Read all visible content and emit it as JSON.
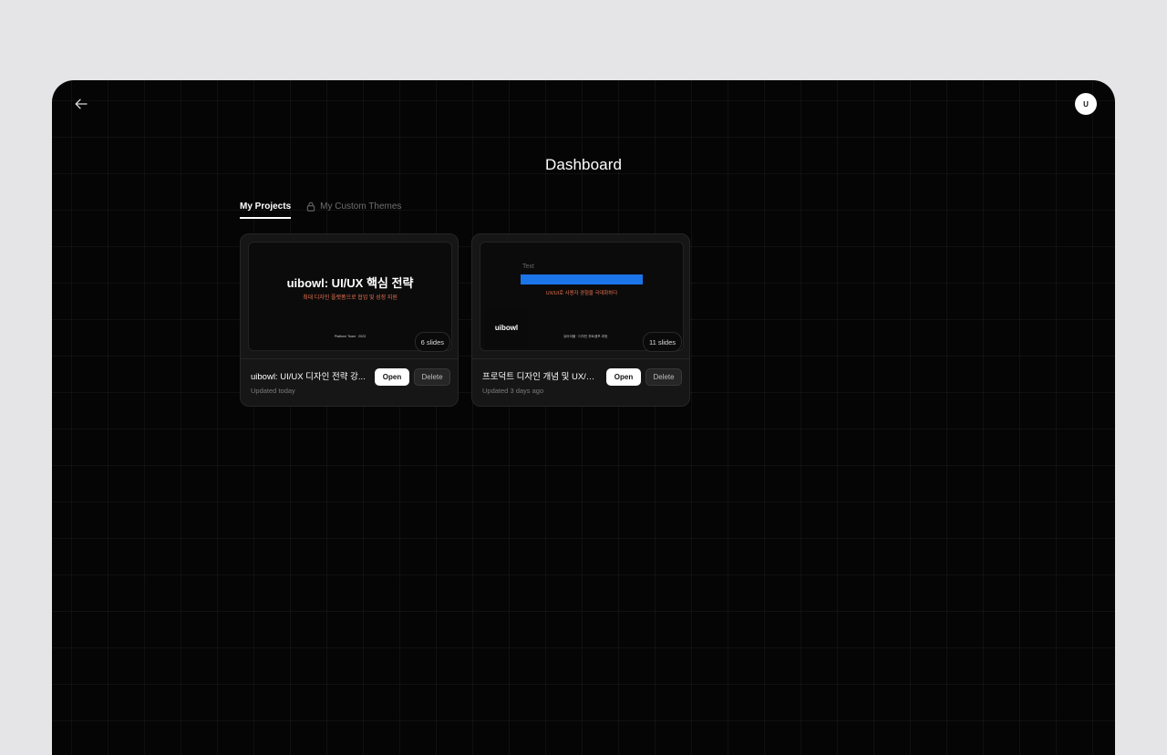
{
  "header": {
    "back_icon": "arrow-left-icon",
    "avatar_initial": "U"
  },
  "page": {
    "title": "Dashboard"
  },
  "tabs": [
    {
      "label": "My Projects",
      "active": true
    },
    {
      "label": "My Custom Themes",
      "active": false,
      "icon": "lock-icon"
    }
  ],
  "projects": [
    {
      "title": "uibowl: UI/UX 디자인 전략 강...",
      "updated": "Updated today",
      "slides": "6 slides",
      "open_label": "Open",
      "delete_label": "Delete",
      "thumbnail": {
        "title": "uibowl: UI/UX 핵심 전략",
        "subtitle": "최대 디자인 플랫폼으로 협업 및 성장 지원",
        "footer": "Platform Team · 2023"
      }
    },
    {
      "title": "프로덕트 디자인 개념 및 UX/UI...",
      "updated": "Updated 3 days ago",
      "slides": "11 slides",
      "open_label": "Open",
      "delete_label": "Delete",
      "thumbnail": {
        "label": "Text",
        "subtitle": "UX/UI로 사용자 경험을 극대화하다",
        "logo": "uibowl",
        "footer": "유아이볼 · 디자인 부트캠프 과정"
      }
    }
  ],
  "colors": {
    "accent_blue": "#1b74e8",
    "accent_orange": "#e8714f",
    "background": "#050505"
  }
}
